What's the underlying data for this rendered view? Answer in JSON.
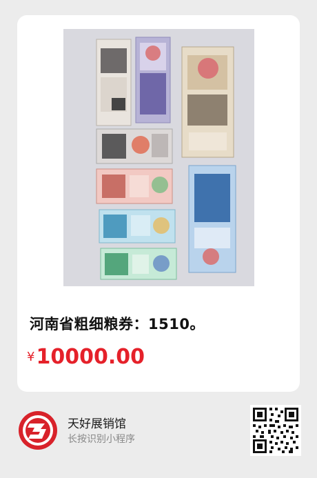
{
  "product": {
    "title": "河南省粗细粮券：1510。",
    "currency_symbol": "¥",
    "price": "10000.00",
    "image_icon": "grain-coupons-photo"
  },
  "shop": {
    "name": "天好展销馆",
    "hint": "长按识别小程序",
    "logo_icon": "shop-logo-icon",
    "qr_icon": "mini-program-qr-icon"
  },
  "colors": {
    "price": "#e5212a",
    "logo_red": "#d8222a",
    "background": "#ececec"
  }
}
